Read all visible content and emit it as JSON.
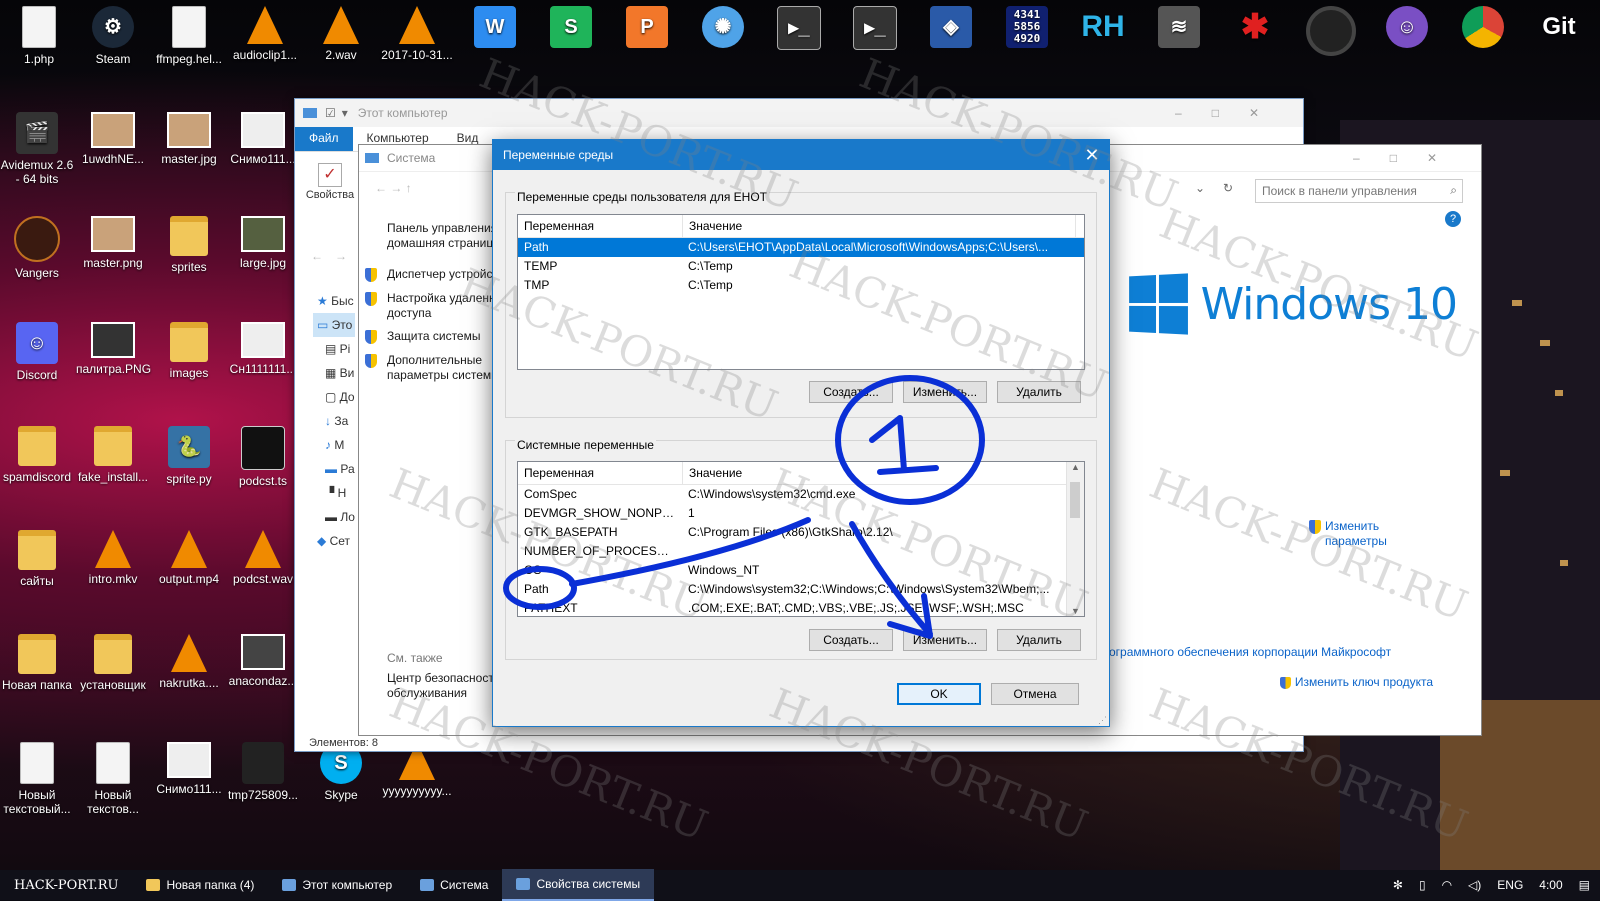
{
  "desktop": {
    "icons": [
      {
        "label": "1.php",
        "icon": "php-file-icon"
      },
      {
        "label": "Steam",
        "icon": "steam-icon"
      },
      {
        "label": "ffmpeg.hel...",
        "icon": "text-file-icon"
      },
      {
        "label": "audioclip1...",
        "icon": "vlc-icon"
      },
      {
        "label": "2.wav",
        "icon": "vlc-icon"
      },
      {
        "label": "2017-10-31...",
        "icon": "vlc-icon"
      },
      {
        "label": "Avidemux 2.6 - 64 bits",
        "icon": "avidemux-icon"
      },
      {
        "label": "1uwdhNE...",
        "icon": "image-file-icon"
      },
      {
        "label": "master.jpg",
        "icon": "image-file-icon"
      },
      {
        "label": "Снимо111...",
        "icon": "image-file-icon"
      },
      {
        "label": "Vangers",
        "icon": "vangers-icon"
      },
      {
        "label": "master.png",
        "icon": "image-file-icon"
      },
      {
        "label": "sprites",
        "icon": "folder-icon"
      },
      {
        "label": "large.jpg",
        "icon": "image-file-icon"
      },
      {
        "label": "Discord",
        "icon": "discord-icon"
      },
      {
        "label": "палитра.PNG",
        "icon": "image-file-icon"
      },
      {
        "label": "images",
        "icon": "folder-icon"
      },
      {
        "label": "Сн1111111...",
        "icon": "image-file-icon"
      },
      {
        "label": "spamdiscord",
        "icon": "folder-icon"
      },
      {
        "label": "fake_install...",
        "icon": "folder-icon"
      },
      {
        "label": "sprite.py",
        "icon": "python-file-icon"
      },
      {
        "label": "podcst.ts",
        "icon": "video-file-icon"
      },
      {
        "label": "сайты",
        "icon": "folder-icon"
      },
      {
        "label": "intro.mkv",
        "icon": "vlc-icon"
      },
      {
        "label": "output.mp4",
        "icon": "vlc-icon"
      },
      {
        "label": "podcst.wav",
        "icon": "vlc-icon"
      },
      {
        "label": "Новая папка",
        "icon": "folder-icon"
      },
      {
        "label": "установщик",
        "icon": "folder-icon"
      },
      {
        "label": "nakrutka....",
        "icon": "vlc-icon"
      },
      {
        "label": "anacondaz...",
        "icon": "image-file-icon"
      },
      {
        "label": "Новый текстовый...",
        "icon": "text-file-icon"
      },
      {
        "label": "Новый текстов...",
        "icon": "text-file-icon"
      },
      {
        "label": "Снимо111...",
        "icon": "image-file-icon"
      },
      {
        "label": "tmp725809...",
        "icon": "image-file-icon"
      },
      {
        "label": "Skype",
        "icon": "skype-icon"
      },
      {
        "label": "yyyyyyyyyy...",
        "icon": "vlc-icon"
      }
    ],
    "top_icons": {
      "app7": "W",
      "app8": "S",
      "app9": "P",
      "clock_digits": "4341 5856 4920",
      "rh": "RH",
      "git": "Git"
    }
  },
  "explorer": {
    "title": "Этот компьютер",
    "tabs": [
      "Файл",
      "Компьютер",
      "Вид"
    ],
    "properties_label": "Свойства",
    "status": "Элементов: 8",
    "nav": [
      "Быс",
      "Это",
      "Pi",
      "Ви",
      "До",
      "За",
      "М",
      "Ра",
      "Н",
      "Ло",
      "Сет"
    ]
  },
  "system": {
    "title": "Система",
    "search_placeholder": "Поиск в панели управления",
    "leftpane": {
      "home": "Панель управления — домашняя страница",
      "items": [
        "Диспетчер устройств",
        "Настройка удаленного доступа",
        "Защита системы",
        "Дополнительные параметры системы"
      ],
      "see_also": "См. также",
      "security": "Центр безопасности и обслуживания"
    },
    "windows_brand": "Windows 10",
    "change_params": "Изменить параметры",
    "ms_software": "ограммного обеспечения корпорации Майкрософт",
    "change_key": "Изменить ключ продукта"
  },
  "dialog": {
    "title": "Переменные среды",
    "user_group_label": "Переменные среды пользователя для ЕНОТ",
    "columns": {
      "name": "Переменная",
      "value": "Значение"
    },
    "user_vars": [
      {
        "name": "Path",
        "value": "C:\\Users\\ЕНОТ\\AppData\\Local\\Microsoft\\WindowsApps;C:\\Users\\..."
      },
      {
        "name": "TEMP",
        "value": "C:\\Temp"
      },
      {
        "name": "TMP",
        "value": "C:\\Temp"
      }
    ],
    "system_group_label": "Системные переменные",
    "system_vars": [
      {
        "name": "ComSpec",
        "value": "C:\\Windows\\system32\\cmd.exe"
      },
      {
        "name": "DEVMGR_SHOW_NONPRESE...",
        "value": "1"
      },
      {
        "name": "GTK_BASEPATH",
        "value": "C:\\Program Files (x86)\\GtkSharp\\2.12\\"
      },
      {
        "name": "NUMBER_OF_PROCESSORS",
        "value": ""
      },
      {
        "name": "OS",
        "value": "Windows_NT"
      },
      {
        "name": "Path",
        "value": "C:\\Windows\\system32;C:\\Windows;C:\\Windows\\System32\\Wbem;..."
      },
      {
        "name": "PATHEXT",
        "value": ".COM;.EXE;.BAT;.CMD;.VBS;.VBE;.JS;.JSE;.WSF;.WSH;.MSC"
      }
    ],
    "buttons": {
      "create": "Создать...",
      "edit": "Изменить...",
      "delete": "Удалить",
      "ok": "OK",
      "cancel": "Отмена"
    }
  },
  "annotation": {
    "number": "1"
  },
  "watermark": "HACK-PORT.RU",
  "taskbar": {
    "start": "HACK-PORT.RU",
    "items": [
      "Новая папка (4)",
      "Этот компьютер",
      "Система",
      "Свойства системы"
    ],
    "lang": "ENG",
    "time": "4:00"
  },
  "colors": {
    "accent": "#1979ca",
    "selection": "#0078d7",
    "marker": "#0a2fd6",
    "win10": "#0e7fd5"
  }
}
